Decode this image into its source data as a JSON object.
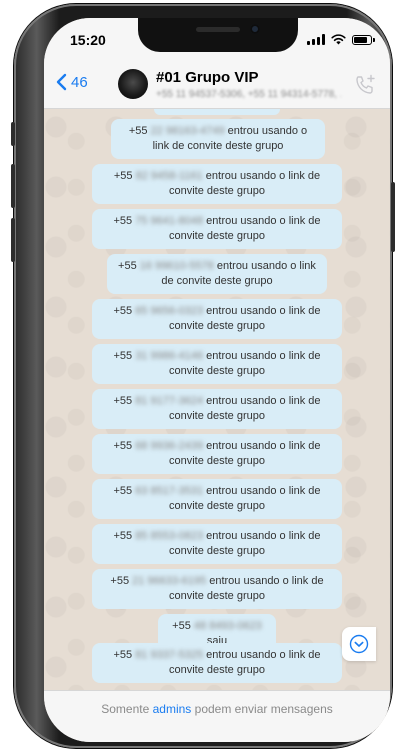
{
  "status_bar": {
    "time": "15:20",
    "battery_level": 0.85
  },
  "header": {
    "back_count": "46",
    "title": "#01 Grupo VIP",
    "subtitle": "+55 11 94537-5306, +55 11 94314-5778, ..."
  },
  "messages": [
    {
      "prefix": "+55",
      "number": "22 98163-4749",
      "text": "entrou usando o link de convite deste grupo"
    },
    {
      "prefix": "+55",
      "number": "82 9458-1161",
      "text": "entrou usando o link de convite deste grupo"
    },
    {
      "prefix": "+55",
      "number": "75 9641-8048",
      "text": "entrou usando o link de convite deste grupo"
    },
    {
      "prefix": "+55",
      "number": "16 99610-5578",
      "text": "entrou usando o link de convite deste grupo"
    },
    {
      "prefix": "+55",
      "number": "65 9656-0323",
      "text": "entrou usando o link de convite deste grupo"
    },
    {
      "prefix": "+55",
      "number": "31 9986-4146",
      "text": "entrou usando o link de convite deste grupo"
    },
    {
      "prefix": "+55",
      "number": "81 9177-3624",
      "text": "entrou usando o link de convite deste grupo"
    },
    {
      "prefix": "+55",
      "number": "68 9936-2439",
      "text": "entrou usando o link de convite deste grupo"
    },
    {
      "prefix": "+55",
      "number": "63 8517-3531",
      "text": "entrou usando o link de convite deste grupo"
    },
    {
      "prefix": "+55",
      "number": "85 8553-0823",
      "text": "entrou usando o link de convite deste grupo"
    },
    {
      "prefix": "+55",
      "number": "21 96633-6195",
      "text": "entrou usando o link de convite deste grupo"
    },
    {
      "prefix": "+55",
      "number": "48 8493-0623",
      "text": "saiu"
    },
    {
      "prefix": "+55",
      "number": "81 9337-5325",
      "text": "entrou usando o link de convite deste grupo"
    }
  ],
  "footer": {
    "before": "Somente",
    "link": "admins",
    "after": "podem enviar mensagens"
  },
  "colors": {
    "accent": "#1a7cf0",
    "bubble": "#d9edf7",
    "wallpaper": "#e6ddd3"
  }
}
